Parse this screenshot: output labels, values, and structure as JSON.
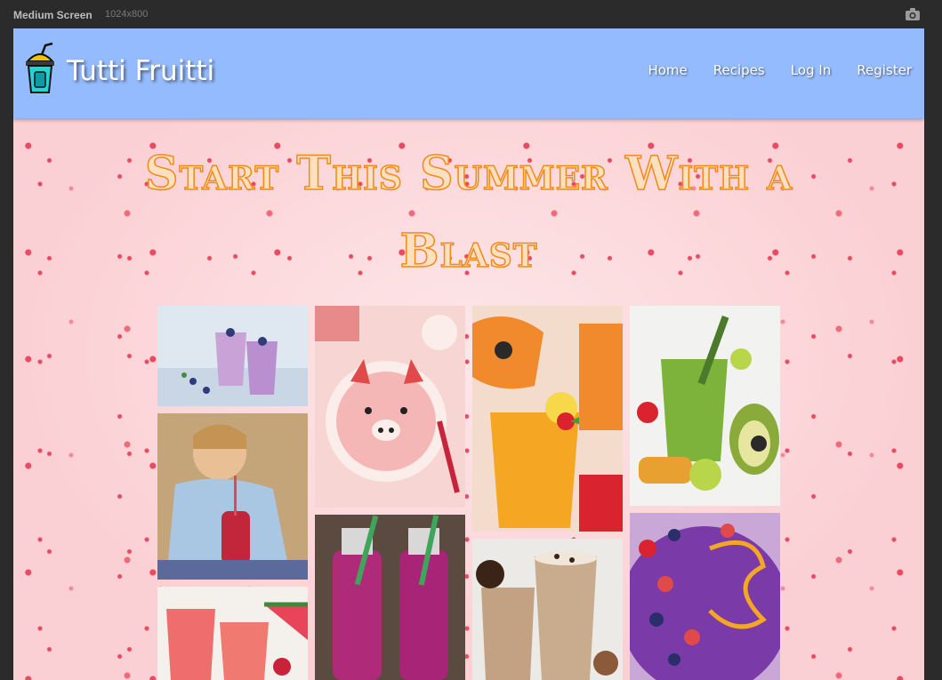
{
  "window": {
    "label": "Medium Screen",
    "dims": "1024x800"
  },
  "brand": {
    "name": "Tutti Fruitti",
    "logo_icon": "smoothie-cup-icon"
  },
  "nav": [
    {
      "label": "Home"
    },
    {
      "label": "Recipes"
    },
    {
      "label": "Log In"
    },
    {
      "label": "Register"
    }
  ],
  "hero": {
    "line1": "Start This Summer With a",
    "line2": "Blast"
  },
  "gallery": [
    {
      "name": "blueberry-smoothie-glasses"
    },
    {
      "name": "child-drinking-smoothie"
    },
    {
      "name": "watermelon-smoothie"
    },
    {
      "name": "pig-face-smoothie-bowl"
    },
    {
      "name": "berry-smoothie-bottles"
    },
    {
      "name": "mango-papaya-smoothie"
    },
    {
      "name": "coffee-smoothie"
    },
    {
      "name": "green-smoothie"
    },
    {
      "name": "acai-berry-bowl"
    }
  ],
  "colors": {
    "navbar": "#94bbfd",
    "hero_text": "#f28a17",
    "background": "#fbd3d6"
  }
}
